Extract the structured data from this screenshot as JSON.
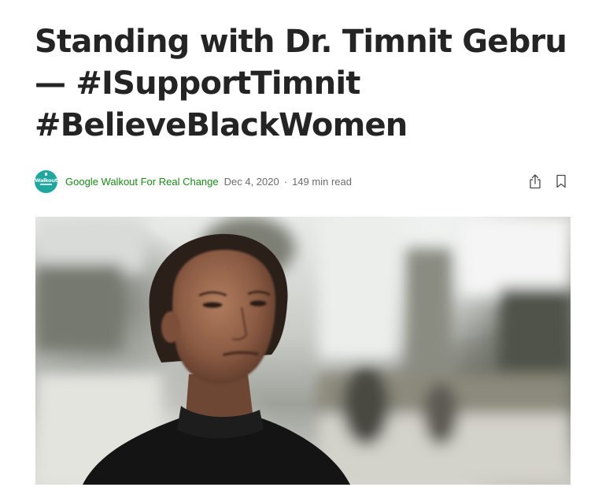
{
  "article": {
    "title_lines": [
      "Standing with Dr. Timnit Gebru",
      "— #ISupportTimnit",
      "#BelieveBlackWomen"
    ]
  },
  "byline": {
    "avatar_text": "Walkout",
    "author": "Google Walkout For Real Change",
    "date": "Dec 4, 2020",
    "separator": "·",
    "read_time": "149 min read"
  },
  "actions": {
    "share_icon": "share-icon",
    "bookmark_icon": "bookmark-icon"
  },
  "colors": {
    "author_green": "#1a8917",
    "meta_gray": "#6b6b6b",
    "title": "#242424",
    "avatar_teal": "#1fa7a0"
  }
}
